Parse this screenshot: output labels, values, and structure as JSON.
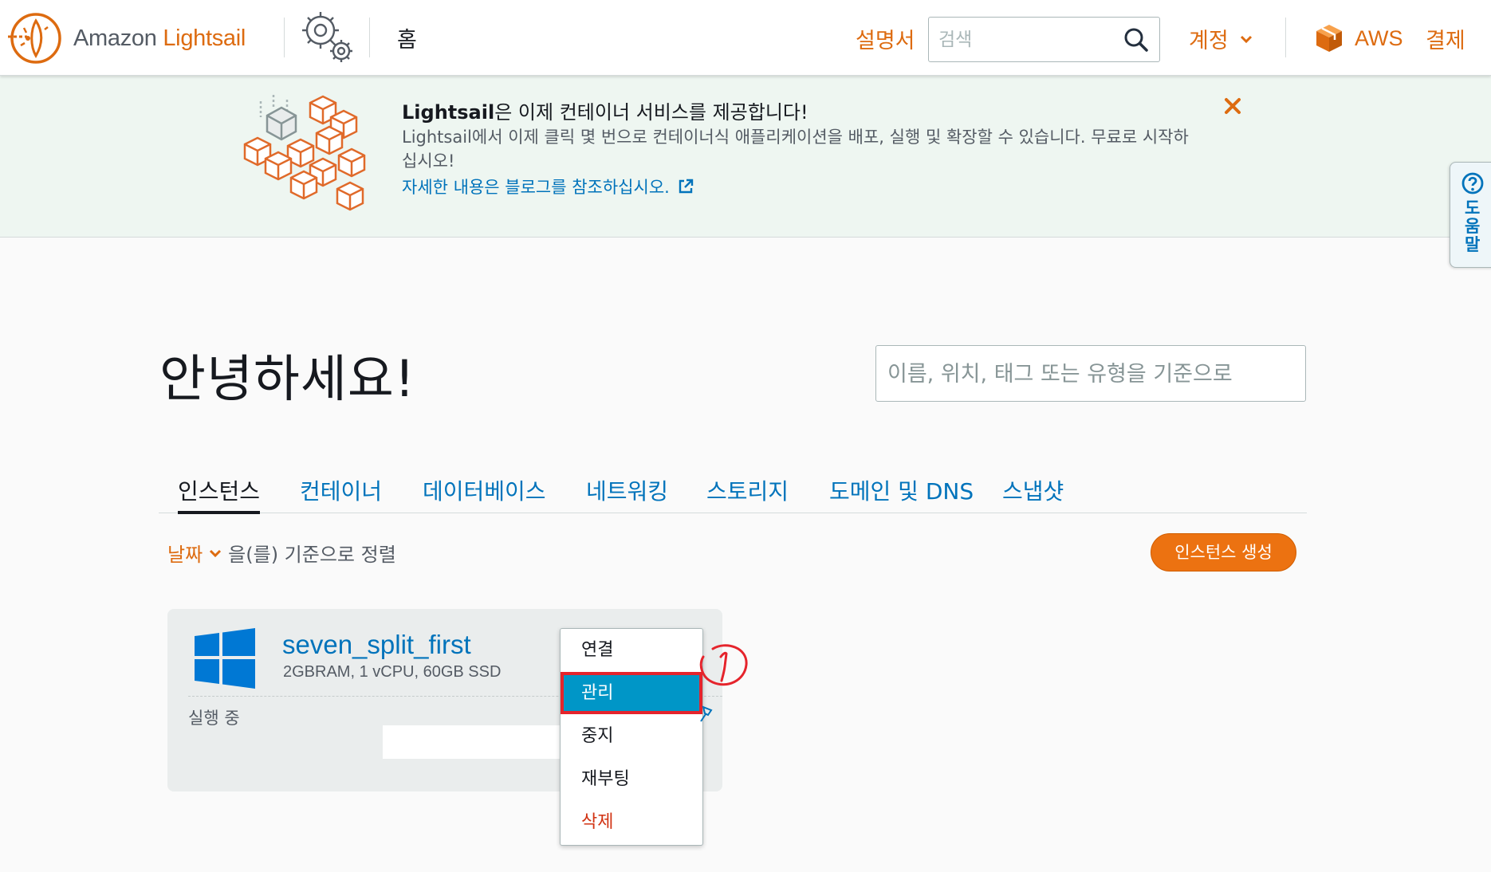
{
  "header": {
    "brand_prefix": "Amazon ",
    "brand_accent": "Lightsail",
    "home": "홈",
    "manual": "설명서",
    "search_placeholder": "검색",
    "account": "계정",
    "aws": "AWS",
    "billing": "결제"
  },
  "banner": {
    "title_strong": "Lightsail",
    "title_rest": "은 이제 컨테이너 서비스를 제공합니다!",
    "body": "Lightsail에서 이제 클릭 몇 번으로 컨테이너식 애플리케이션을 배포, 실행 및 확장할 수 있습니다. 무료로 시작하십시오!",
    "link": "자세한 내용은 블로그를 참조하십시오."
  },
  "help_tab": {
    "label": "도움말"
  },
  "main": {
    "greeting": "안녕하세요!",
    "filter_placeholder": "이름, 위치, 태그 또는 유형을 기준으로"
  },
  "tabs": [
    {
      "label": "인스턴스",
      "active": true
    },
    {
      "label": "컨테이너",
      "active": false
    },
    {
      "label": "데이터베이스",
      "active": false
    },
    {
      "label": "네트워킹",
      "active": false
    },
    {
      "label": "스토리지",
      "active": false
    },
    {
      "label": "도메인 및 DNS",
      "active": false
    },
    {
      "label": "스냅샷",
      "active": false
    }
  ],
  "sort": {
    "key": "날짜",
    "suffix": "을(를) 기준으로 정렬"
  },
  "create_button": "인스턴스 생성",
  "instance": {
    "name": "seven_split_first",
    "specs": "2GBRAM, 1 vCPU, 60GB SSD",
    "state": "실행 중",
    "os_icon": "windows-logo-icon"
  },
  "context_menu": [
    {
      "label": "연결",
      "selected": false
    },
    {
      "label": "관리",
      "selected": true
    },
    {
      "label": "중지",
      "selected": false
    },
    {
      "label": "재부팅",
      "selected": false
    },
    {
      "label": "삭제",
      "selected": false,
      "danger": true
    }
  ],
  "colors": {
    "accent_orange": "#dd6b10",
    "link_blue": "#0073bb",
    "banner_bg": "#eef6f1",
    "menu_highlight": "#0096c7",
    "annotation_red": "#e5242c"
  }
}
